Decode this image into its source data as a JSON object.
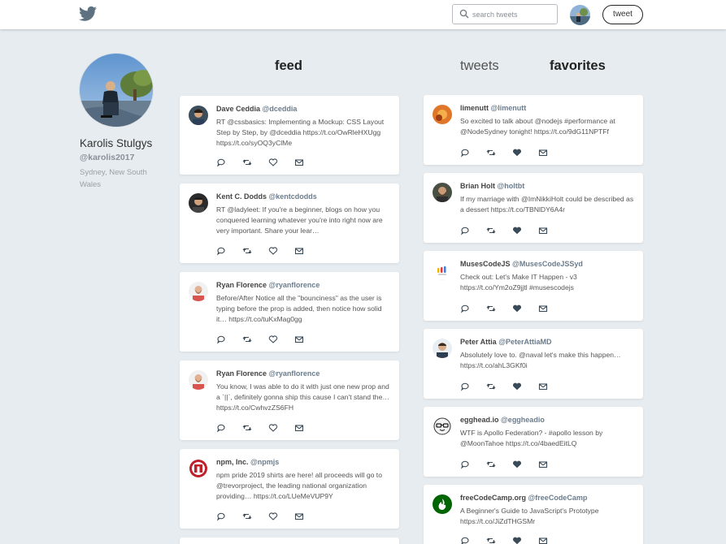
{
  "header": {
    "logo_icon": "twitter-bird-icon",
    "search": {
      "placeholder": "search tweets",
      "icon": "search-icon"
    },
    "tweet_button": "tweet"
  },
  "profile": {
    "name": "Karolis Stulgys",
    "handle": "@karolis2017",
    "location": "Sydney, New South Wales"
  },
  "headings": {
    "feed": "feed",
    "tweets": "tweets",
    "favorites": "favorites"
  },
  "feed": [
    {
      "name": "Dave Ceddia",
      "handle": "@dceddia",
      "text": "RT @cssbasics: Implementing a Mockup: CSS Layout Step by Step, by @dceddia https://t.co/OwRleHXUgg https://t.co/syOQ3yClMe"
    },
    {
      "name": "Kent C. Dodds",
      "handle": "@kentcdodds",
      "text": "RT @ladyleet: If you're a beginner, blogs on how you conquered learning whatever you're into right now are very important. Share your lear…"
    },
    {
      "name": "Ryan Florence",
      "handle": "@ryanflorence",
      "text": "Before/After Notice all the \"bounciness\" as the user is typing before the prop is added, then notice how solid it… https://t.co/tuKxMag0gg"
    },
    {
      "name": "Ryan Florence",
      "handle": "@ryanflorence",
      "text": "You know, I was able to do it with just one new prop and a `||`, definitely gonna ship this cause I can't stand the… https://t.co/CwhvzZS6FH"
    },
    {
      "name": "npm, Inc.",
      "handle": "@npmjs",
      "text": "npm pride 2019 shirts are here! all proceeds will go to @trevorproject, the leading national organization providing… https://t.co/LUeMeVUP9Y"
    }
  ],
  "favorites": [
    {
      "name": "limenutt",
      "handle": "@limenutt",
      "text": "So excited to talk about @nodejs #performance at @NodeSydney tonight! https://t.co/9dG11NPTFf"
    },
    {
      "name": "Brian Holt",
      "handle": "@holtbt",
      "text": "If my marriage with @ImNikkiHolt could be described as a dessert https://t.co/TBNlDY6A4r"
    },
    {
      "name": "MusesCodeJS",
      "handle": "@MusesCodeJSSyd",
      "text": "Check out: Let's Make IT Happen - v3 https://t.co/Ym2oZ9jjtl #musescodejs"
    },
    {
      "name": "Peter Attia",
      "handle": "@PeterAttiaMD",
      "text": "Absolutely love to. @naval let's make this happen… https://t.co/ahL3GKf0i"
    },
    {
      "name": "egghead.io",
      "handle": "@eggheadio",
      "text": "WTF is Apollo Federation? - #apollo lesson by @MoonTahoe https://t.co/4baedEitLQ"
    },
    {
      "name": "freeCodeCamp.org",
      "handle": "@freeCodeCamp",
      "text": "A Beginner's Guide to JavaScript's Prototype https://t.co/JiZdTHGSMr"
    }
  ],
  "colors": {
    "background": "#e6ecf0",
    "card": "#ffffff",
    "icon": "#3b4a57",
    "twitter_logo": "#5d7180"
  }
}
